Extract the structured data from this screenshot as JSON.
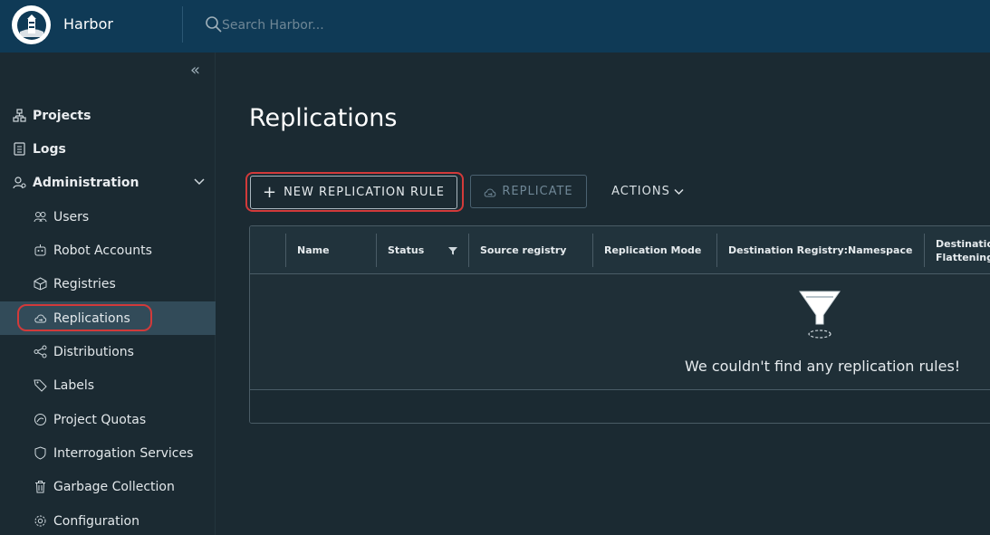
{
  "header": {
    "app_title": "Harbor",
    "search_placeholder": "Search Harbor..."
  },
  "sidebar": {
    "items": [
      {
        "label": "Projects",
        "icon": "projects-icon"
      },
      {
        "label": "Logs",
        "icon": "logs-icon"
      },
      {
        "label": "Administration",
        "icon": "administration-icon"
      }
    ],
    "admin_items": [
      {
        "label": "Users",
        "icon": "users-icon"
      },
      {
        "label": "Robot Accounts",
        "icon": "robot-icon"
      },
      {
        "label": "Registries",
        "icon": "registries-icon"
      },
      {
        "label": "Replications",
        "icon": "replications-icon"
      },
      {
        "label": "Distributions",
        "icon": "distributions-icon"
      },
      {
        "label": "Labels",
        "icon": "labels-icon"
      },
      {
        "label": "Project Quotas",
        "icon": "quotas-icon"
      },
      {
        "label": "Interrogation Services",
        "icon": "interrogation-icon"
      },
      {
        "label": "Garbage Collection",
        "icon": "trash-icon"
      },
      {
        "label": "Configuration",
        "icon": "gear-icon"
      }
    ],
    "active_item": "Replications"
  },
  "main": {
    "title": "Replications",
    "toolbar": {
      "new_rule_label": "NEW REPLICATION RULE",
      "replicate_label": "REPLICATE",
      "actions_label": "ACTIONS"
    },
    "grid": {
      "columns": [
        "Name",
        "Status",
        "Source registry",
        "Replication Mode",
        "Destination Registry:Namespace",
        "Destination",
        "Flattening"
      ],
      "empty_message": "We couldn't find any replication rules!"
    }
  },
  "colors": {
    "header_bg": "#0f3a56",
    "page_bg": "#1b2a32",
    "active_bg": "#324b59",
    "highlight_ring": "#d23a3a"
  }
}
